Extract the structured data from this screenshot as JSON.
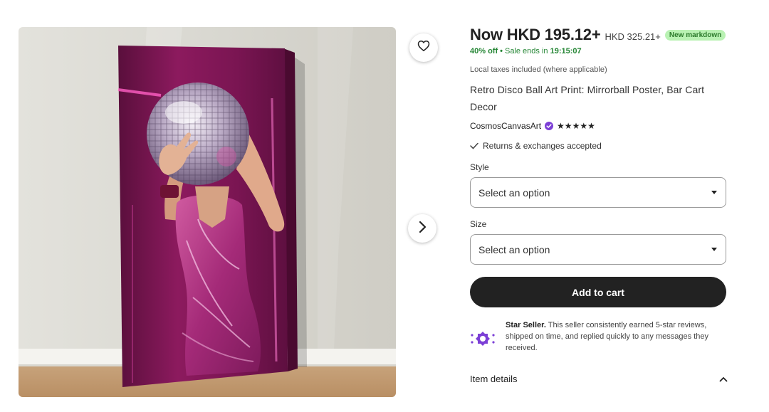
{
  "icons": {
    "favorite": "heart-icon",
    "next": "chevron-right-icon",
    "verified": "verified-badge-icon",
    "rating": "star-icon",
    "returns": "check-icon",
    "dropdown": "caret-down-icon",
    "star_seller": "star-seller-badge-icon",
    "expand": "chevron-up-icon"
  },
  "colors": {
    "sale_green": "#258635",
    "badge_green": "#b9f2b3",
    "star_seller_purple": "#7c3fd6",
    "cart_button": "#222222"
  },
  "listing": {
    "price_now": "Now HKD 195.12+",
    "price_was": "HKD 325.21+",
    "markdown_badge": "New markdown",
    "discount": "40% off",
    "sale_ends_label": "Sale ends in",
    "sale_timer": "19:15:07",
    "taxes_note": "Local taxes included (where applicable)",
    "title": "Retro Disco Ball Art Print: Mirrorball Poster, Bar Cart Decor",
    "seller_name": "CosmosCanvasArt",
    "rating": 5,
    "returns_note": "Returns & exchanges accepted"
  },
  "options": {
    "style_label": "Style",
    "style_value": "Select an option",
    "size_label": "Size",
    "size_value": "Select an option"
  },
  "cart": {
    "add_to_cart_label": "Add to cart"
  },
  "star_seller": {
    "title": "Star Seller.",
    "text": "This seller consistently earned 5-star reviews, shipped on time, and replied quickly to any messages they received."
  },
  "item_details": {
    "label": "Item details"
  }
}
